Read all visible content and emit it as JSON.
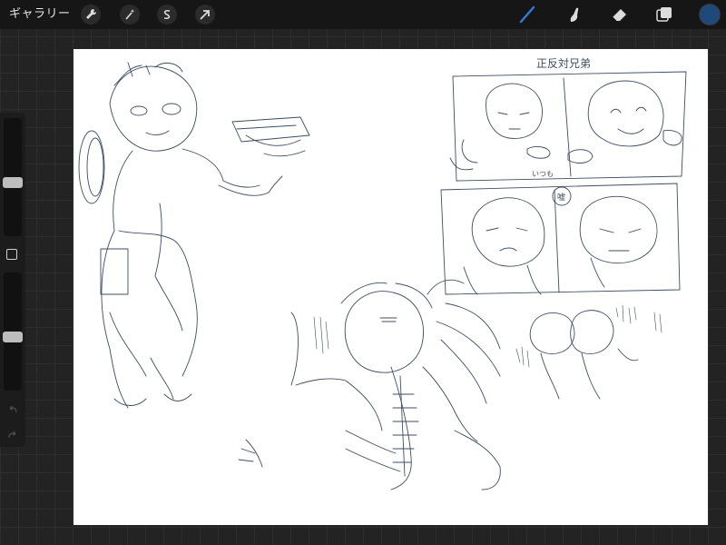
{
  "toolbar": {
    "gallery_label": "ギャラリー",
    "left_tools": [
      "wrench-icon",
      "magic-wand-icon",
      "selection-icon",
      "transform-arrow-icon"
    ],
    "right_tools": [
      "brush-icon",
      "smudge-icon",
      "eraser-icon",
      "layers-icon"
    ],
    "active_tool": "brush-icon",
    "current_color": "#1e4a7a"
  },
  "sidebar": {
    "brush_size": 0.22,
    "opacity": 0.22,
    "undo_icon": "undo-icon",
    "redo_icon": "redo-icon"
  },
  "canvas": {
    "background": "#ffffff",
    "ink_color": "#3d4e62",
    "annotations": {
      "title_jp": "正反対兄弟",
      "bubble_itsumo": "いつも",
      "bubble_uso": "嘘"
    }
  }
}
